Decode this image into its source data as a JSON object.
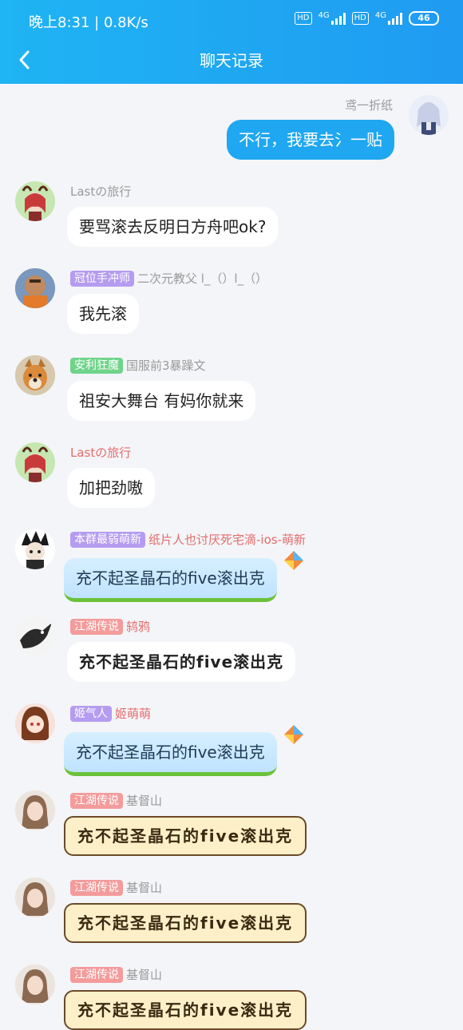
{
  "status": {
    "time": "晚上8:31",
    "speed": "0.8K/s",
    "hd1": "HD",
    "net1": "4G",
    "hd2": "HD",
    "net2": "4G",
    "battery": "46"
  },
  "header": {
    "title": "聊天记录"
  },
  "colors": {
    "header": "#1fa5f2",
    "self_bubble": "#1fa7f1",
    "tag_purple": "#b59cf0",
    "tag_green": "#6fd48a",
    "tag_pink": "#f49b9b"
  },
  "messages": [
    {
      "name": "鸢一折纸",
      "text": "不行，我要去氵一贴",
      "self": true
    },
    {
      "name": "Lastの旅行",
      "text": "要骂滚去反明日方舟吧ok?"
    },
    {
      "tag": "冠位手冲师",
      "name": "二次元教父 l_（）l_（）",
      "text": "我先滚"
    },
    {
      "tag": "安利狂魔",
      "name": "国服前3暴躁文",
      "text": "祖安大舞台 有妈你就来"
    },
    {
      "name": "Lastの旅行",
      "text": "加把劲嗷"
    },
    {
      "tag": "本群最弱萌新",
      "name": "纸片人也讨厌死宅滴-ios-萌新",
      "text": "充不起圣晶石的five滚出克"
    },
    {
      "tag": "江湖传说",
      "name": "鸫鸦",
      "text": "充不起圣晶石的five滚出克"
    },
    {
      "tag": "姬气人",
      "name": "姬萌萌",
      "text": "充不起圣晶石的five滚出克"
    },
    {
      "tag": "江湖传说",
      "name": "基督山",
      "text": "充不起圣晶石的five滚出克"
    },
    {
      "tag": "江湖传说",
      "name": "基督山",
      "text": "充不起圣晶石的five滚出克"
    },
    {
      "tag": "江湖传说",
      "name": "基督山",
      "text": "充不起圣晶石的five滚出克"
    }
  ]
}
